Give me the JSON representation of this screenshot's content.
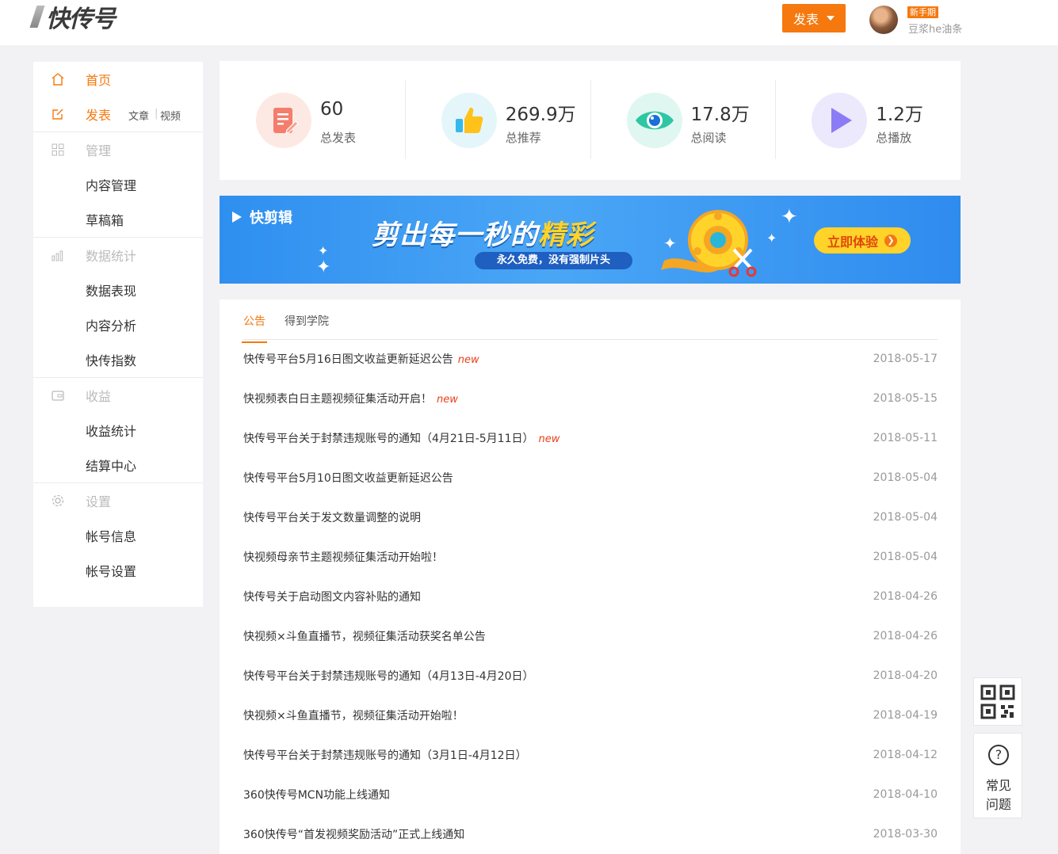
{
  "header": {
    "logo_text": "快传号",
    "publish_label": "发表",
    "badge": "新手期",
    "username": "豆浆he油条"
  },
  "sidebar": {
    "home": "首页",
    "publish": "发表",
    "publish_article": "文章",
    "publish_video": "视频",
    "groups": [
      {
        "label": "管理",
        "icon": "grid-icon",
        "items": [
          "内容管理",
          "草稿箱"
        ]
      },
      {
        "label": "数据统计",
        "icon": "bar-chart-icon",
        "items": [
          "数据表现",
          "内容分析",
          "快传指数"
        ]
      },
      {
        "label": "收益",
        "icon": "wallet-icon",
        "items": [
          "收益统计",
          "结算中心"
        ]
      },
      {
        "label": "设置",
        "icon": "gear-icon",
        "items": [
          "帐号信息",
          "帐号设置"
        ]
      }
    ]
  },
  "stats": [
    {
      "value": "60",
      "label": "总发表",
      "icon": "edit-doc-icon",
      "color": "#f47d6b"
    },
    {
      "value": "269.9万",
      "label": "总推荐",
      "icon": "thumbs-up-icon",
      "color": "#ffc21a"
    },
    {
      "value": "17.8万",
      "label": "总阅读",
      "icon": "eye-icon",
      "color": "#2ec7a3"
    },
    {
      "value": "1.2万",
      "label": "总播放",
      "icon": "play-icon",
      "color": "#8b7cf6"
    }
  ],
  "banner": {
    "brand": "快剪辑",
    "headline_a": "剪出每一秒的",
    "headline_b": "精彩",
    "tag": "永久免费，没有强制片头",
    "cta": "立即体验"
  },
  "news": {
    "tabs": [
      "公告",
      "得到学院"
    ],
    "new_label": "new",
    "items": [
      {
        "title": "快传号平台5月16日图文收益更新延迟公告",
        "date": "2018-05-17",
        "is_new": true
      },
      {
        "title": "快视频表白日主题视频征集活动开启！",
        "date": "2018-05-15",
        "is_new": true
      },
      {
        "title": "快传号平台关于封禁违规账号的通知（4月21日-5月11日）",
        "date": "2018-05-11",
        "is_new": true
      },
      {
        "title": "快传号平台5月10日图文收益更新延迟公告",
        "date": "2018-05-04",
        "is_new": false
      },
      {
        "title": "快传号平台关于发文数量调整的说明",
        "date": "2018-05-04",
        "is_new": false
      },
      {
        "title": "快视频母亲节主题视频征集活动开始啦！",
        "date": "2018-05-04",
        "is_new": false
      },
      {
        "title": "快传号关于启动图文内容补贴的通知",
        "date": "2018-04-26",
        "is_new": false
      },
      {
        "title": "快视频×斗鱼直播节，视频征集活动获奖名单公告",
        "date": "2018-04-26",
        "is_new": false
      },
      {
        "title": "快传号平台关于封禁违规账号的通知（4月13日-4月20日）",
        "date": "2018-04-20",
        "is_new": false
      },
      {
        "title": "快视频×斗鱼直播节，视频征集活动开始啦！",
        "date": "2018-04-19",
        "is_new": false
      },
      {
        "title": "快传号平台关于封禁违规账号的通知（3月1日-4月12日）",
        "date": "2018-04-12",
        "is_new": false
      },
      {
        "title": "360快传号MCN功能上线通知",
        "date": "2018-04-10",
        "is_new": false
      },
      {
        "title": "360快传号“首发视频奖励活动”正式上线通知",
        "date": "2018-03-30",
        "is_new": false
      }
    ]
  },
  "float": {
    "qr_icon": "qr-code-icon",
    "help_line1": "常见",
    "help_line2": "问题",
    "help_icon": "?"
  },
  "colors": {
    "accent": "#f5790f",
    "new_tag": "#e8401c"
  }
}
